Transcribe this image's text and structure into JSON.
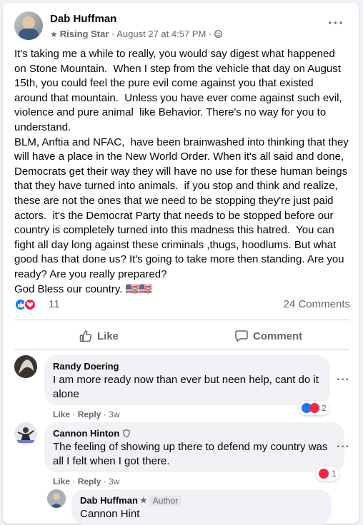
{
  "post": {
    "author": "Dab Huffman",
    "badge": "Rising Star",
    "date": "August 27 at 4:57 PM",
    "separator": "·",
    "body": "It's taking me a while to really, you would say digest what happened on Stone Mountain.  When I step from the vehicle that day on August 15th, you could feel the pure evil come against you that existed around that mountain.  Unless you have ever come against such evil, violence and pure animal  like Behavior. There's no way for you to understand.\nBLM, Anftia and NFAC,  have been brainwashed into thinking that they will have a place in the New World Order. When it's all said and done, Democrats get their way they will have no use for these human beings that they have turned into animals.  if you stop and think and realize, these are not the ones that we need to be stopping they're just paid actors.  it's the Democrat Party that needs to be stopped before our country is completely turned into this madness this hatred.  You can fight all day long against these criminals ,thugs, hoodlums. But what good has that done us? It's going to take more then standing. Are you ready? Are you really prepared?\nGod Bless our country. 🇺🇸🇺🇸",
    "reaction_count": "11",
    "comments_count": "24 Comments",
    "like_label": "Like",
    "comment_label": "Comment"
  },
  "comments": [
    {
      "name": "Randy Doering",
      "text": "I am more ready now than ever but neen help, cant do it alone",
      "like": "Like",
      "reply": "Reply",
      "time": "3w",
      "reactions": "2"
    },
    {
      "name": "Cannon Hinton",
      "text": "The feeling of showing up there to defend my country was all I felt when I got there.",
      "like": "Like",
      "reply": "Reply",
      "time": "3w",
      "reactions": "1"
    }
  ],
  "reply": {
    "name": "Dab Huffman",
    "tag": "Author",
    "text": "Cannon Hint"
  },
  "colors": {
    "like_blue": "#1877f2",
    "love_red": "#f02849",
    "muted": "#65676b"
  }
}
